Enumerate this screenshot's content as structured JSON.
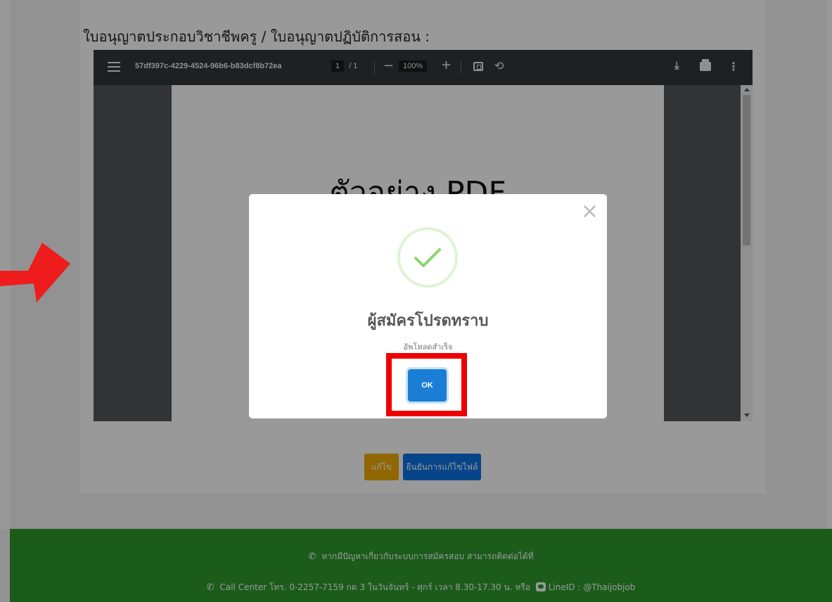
{
  "page": {
    "section_title": "ใบอนุญาตประกอบวิชาชีพครู / ใบอนุญาตปฏิบัติการสอน :",
    "edit_button": "แก้ไข",
    "confirm_button": "ยืนยันการแก้ไขไฟล์"
  },
  "pdf_viewer": {
    "filename": "57df397c-4229-4524-96b6-b83dcf8b72ea",
    "current_page": "1",
    "page_total": "/ 1",
    "zoom_minus": "−",
    "zoom": "100%",
    "zoom_plus": "+",
    "page_heading": "ตัวอย่าง PDF"
  },
  "modal": {
    "title": "ผู้สมัครโปรดทราบ",
    "message": "อัพโหลดสำเร็จ",
    "ok_label": "OK",
    "close_symbol": "×"
  },
  "footer": {
    "line1": "หากมีปัญหาเกี่ยวกับระบบการสมัครสอบ สามารถติดต่อได้ที่",
    "line2_part1": "Call Center โทร. 0-2257-7159 กด 3 ในวันจันทร์ - ศุกร์ เวลา 8.30-17.30 น. หรือ",
    "line2_part2": "LineID : @Thaijobjob"
  },
  "colors": {
    "footer_green": "#2d9a2d",
    "edit_yellow": "#f0ac00",
    "confirm_blue": "#0b74e5",
    "ok_blue": "#1a7fd4",
    "highlight_red": "#ee0000",
    "success_green": "#8cd46c"
  }
}
